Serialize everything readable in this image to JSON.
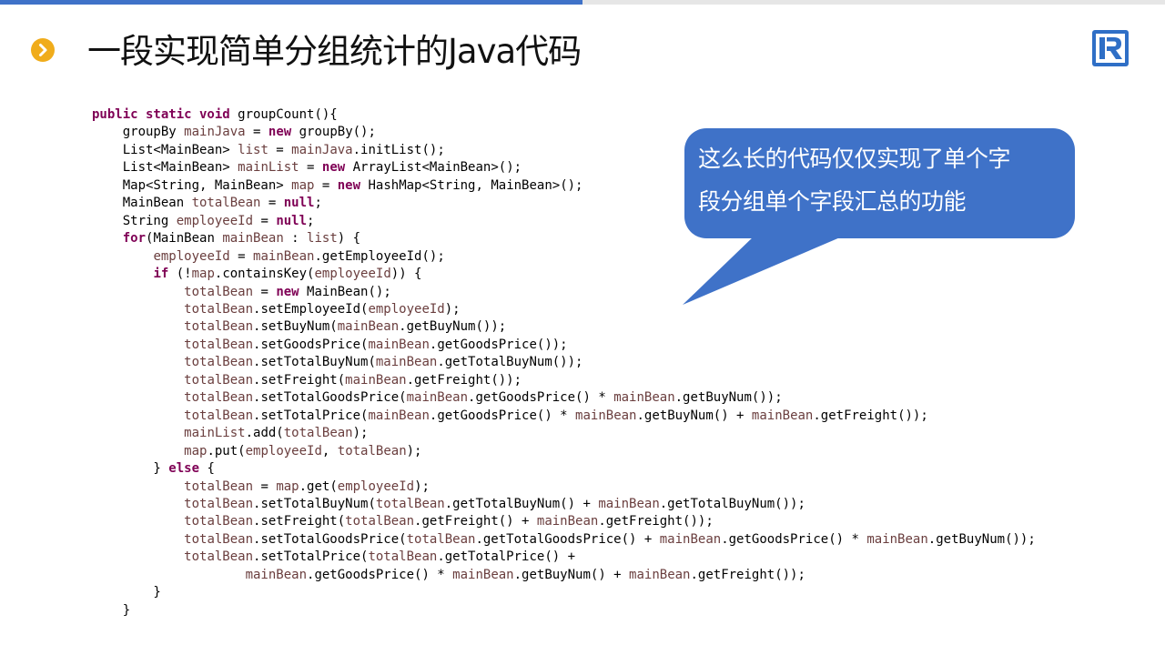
{
  "title": "一段实现简单分组统计的Java代码",
  "callout": {
    "line1": "这么长的代码仅仅实现了单个字",
    "line2": "段分组单个字段汇总的功能",
    "color": "#3f72c8"
  },
  "icons": {
    "bullet": "chevron-right-icon",
    "logo": "r-logo-icon"
  },
  "colors": {
    "accent_blue": "#3f72c8",
    "bullet_orange": "#f0ac1b",
    "keyword": "#7f0055"
  },
  "code_lines": [
    [
      {
        "t": "public static void",
        "c": "kw"
      },
      {
        "t": " groupCount(){"
      }
    ],
    [
      {
        "t": "    groupBy "
      },
      {
        "t": "mainJava",
        "c": "lv"
      },
      {
        "t": " = "
      },
      {
        "t": "new",
        "c": "kw"
      },
      {
        "t": " groupBy();"
      }
    ],
    [
      {
        "t": "    List<MainBean> "
      },
      {
        "t": "list",
        "c": "lv"
      },
      {
        "t": " = "
      },
      {
        "t": "mainJava",
        "c": "lv"
      },
      {
        "t": ".initList();"
      }
    ],
    [
      {
        "t": "    List<MainBean> "
      },
      {
        "t": "mainList",
        "c": "lv"
      },
      {
        "t": " = "
      },
      {
        "t": "new",
        "c": "kw"
      },
      {
        "t": " ArrayList<MainBean>();"
      }
    ],
    [
      {
        "t": "    Map<String, MainBean> "
      },
      {
        "t": "map",
        "c": "lv"
      },
      {
        "t": " = "
      },
      {
        "t": "new",
        "c": "kw"
      },
      {
        "t": " HashMap<String, MainBean>();"
      }
    ],
    [
      {
        "t": "    MainBean "
      },
      {
        "t": "totalBean",
        "c": "lv"
      },
      {
        "t": " = "
      },
      {
        "t": "null",
        "c": "kw"
      },
      {
        "t": ";"
      }
    ],
    [
      {
        "t": "    String "
      },
      {
        "t": "employeeId",
        "c": "lv"
      },
      {
        "t": " = "
      },
      {
        "t": "null",
        "c": "kw"
      },
      {
        "t": ";"
      }
    ],
    [
      {
        "t": "    "
      },
      {
        "t": "for",
        "c": "kw"
      },
      {
        "t": "(MainBean "
      },
      {
        "t": "mainBean",
        "c": "lv"
      },
      {
        "t": " : "
      },
      {
        "t": "list",
        "c": "lv"
      },
      {
        "t": ") {"
      }
    ],
    [
      {
        "t": "        "
      },
      {
        "t": "employeeId",
        "c": "lv"
      },
      {
        "t": " = "
      },
      {
        "t": "mainBean",
        "c": "lv"
      },
      {
        "t": ".getEmployeeId();"
      }
    ],
    [
      {
        "t": "        "
      },
      {
        "t": "if",
        "c": "kw"
      },
      {
        "t": " (!"
      },
      {
        "t": "map",
        "c": "lv"
      },
      {
        "t": ".containsKey("
      },
      {
        "t": "employeeId",
        "c": "lv"
      },
      {
        "t": ")) {"
      }
    ],
    [
      {
        "t": "            "
      },
      {
        "t": "totalBean",
        "c": "lv"
      },
      {
        "t": " = "
      },
      {
        "t": "new",
        "c": "kw"
      },
      {
        "t": " MainBean();"
      }
    ],
    [
      {
        "t": "            "
      },
      {
        "t": "totalBean",
        "c": "lv"
      },
      {
        "t": ".setEmployeeId("
      },
      {
        "t": "employeeId",
        "c": "lv"
      },
      {
        "t": ");"
      }
    ],
    [
      {
        "t": "            "
      },
      {
        "t": "totalBean",
        "c": "lv"
      },
      {
        "t": ".setBuyNum("
      },
      {
        "t": "mainBean",
        "c": "lv"
      },
      {
        "t": ".getBuyNum());"
      }
    ],
    [
      {
        "t": "            "
      },
      {
        "t": "totalBean",
        "c": "lv"
      },
      {
        "t": ".setGoodsPrice("
      },
      {
        "t": "mainBean",
        "c": "lv"
      },
      {
        "t": ".getGoodsPrice());"
      }
    ],
    [
      {
        "t": "            "
      },
      {
        "t": "totalBean",
        "c": "lv"
      },
      {
        "t": ".setTotalBuyNum("
      },
      {
        "t": "mainBean",
        "c": "lv"
      },
      {
        "t": ".getTotalBuyNum());"
      }
    ],
    [
      {
        "t": "            "
      },
      {
        "t": "totalBean",
        "c": "lv"
      },
      {
        "t": ".setFreight("
      },
      {
        "t": "mainBean",
        "c": "lv"
      },
      {
        "t": ".getFreight());"
      }
    ],
    [
      {
        "t": "            "
      },
      {
        "t": "totalBean",
        "c": "lv"
      },
      {
        "t": ".setTotalGoodsPrice("
      },
      {
        "t": "mainBean",
        "c": "lv"
      },
      {
        "t": ".getGoodsPrice() * "
      },
      {
        "t": "mainBean",
        "c": "lv"
      },
      {
        "t": ".getBuyNum());"
      }
    ],
    [
      {
        "t": "            "
      },
      {
        "t": "totalBean",
        "c": "lv"
      },
      {
        "t": ".setTotalPrice("
      },
      {
        "t": "mainBean",
        "c": "lv"
      },
      {
        "t": ".getGoodsPrice() * "
      },
      {
        "t": "mainBean",
        "c": "lv"
      },
      {
        "t": ".getBuyNum() + "
      },
      {
        "t": "mainBean",
        "c": "lv"
      },
      {
        "t": ".getFreight());"
      }
    ],
    [
      {
        "t": "            "
      },
      {
        "t": "mainList",
        "c": "lv"
      },
      {
        "t": ".add("
      },
      {
        "t": "totalBean",
        "c": "lv"
      },
      {
        "t": ");"
      }
    ],
    [
      {
        "t": "            "
      },
      {
        "t": "map",
        "c": "lv"
      },
      {
        "t": ".put("
      },
      {
        "t": "employeeId",
        "c": "lv"
      },
      {
        "t": ", "
      },
      {
        "t": "totalBean",
        "c": "lv"
      },
      {
        "t": ");"
      }
    ],
    [
      {
        "t": "        } "
      },
      {
        "t": "else",
        "c": "kw"
      },
      {
        "t": " {"
      }
    ],
    [
      {
        "t": "            "
      },
      {
        "t": "totalBean",
        "c": "lv"
      },
      {
        "t": " = "
      },
      {
        "t": "map",
        "c": "lv"
      },
      {
        "t": ".get("
      },
      {
        "t": "employeeId",
        "c": "lv"
      },
      {
        "t": ");"
      }
    ],
    [
      {
        "t": "            "
      },
      {
        "t": "totalBean",
        "c": "lv"
      },
      {
        "t": ".setTotalBuyNum("
      },
      {
        "t": "totalBean",
        "c": "lv"
      },
      {
        "t": ".getTotalBuyNum() + "
      },
      {
        "t": "mainBean",
        "c": "lv"
      },
      {
        "t": ".getTotalBuyNum());"
      }
    ],
    [
      {
        "t": "            "
      },
      {
        "t": "totalBean",
        "c": "lv"
      },
      {
        "t": ".setFreight("
      },
      {
        "t": "totalBean",
        "c": "lv"
      },
      {
        "t": ".getFreight() + "
      },
      {
        "t": "mainBean",
        "c": "lv"
      },
      {
        "t": ".getFreight());"
      }
    ],
    [
      {
        "t": "            "
      },
      {
        "t": "totalBean",
        "c": "lv"
      },
      {
        "t": ".setTotalGoodsPrice("
      },
      {
        "t": "totalBean",
        "c": "lv"
      },
      {
        "t": ".getTotalGoodsPrice() + "
      },
      {
        "t": "mainBean",
        "c": "lv"
      },
      {
        "t": ".getGoodsPrice() * "
      },
      {
        "t": "mainBean",
        "c": "lv"
      },
      {
        "t": ".getBuyNum());"
      }
    ],
    [
      {
        "t": "            "
      },
      {
        "t": "totalBean",
        "c": "lv"
      },
      {
        "t": ".setTotalPrice("
      },
      {
        "t": "totalBean",
        "c": "lv"
      },
      {
        "t": ".getTotalPrice() +"
      }
    ],
    [
      {
        "t": "                    "
      },
      {
        "t": "mainBean",
        "c": "lv"
      },
      {
        "t": ".getGoodsPrice() * "
      },
      {
        "t": "mainBean",
        "c": "lv"
      },
      {
        "t": ".getBuyNum() + "
      },
      {
        "t": "mainBean",
        "c": "lv"
      },
      {
        "t": ".getFreight());"
      }
    ],
    [
      {
        "t": "        }"
      }
    ],
    [
      {
        "t": "    }"
      }
    ]
  ]
}
